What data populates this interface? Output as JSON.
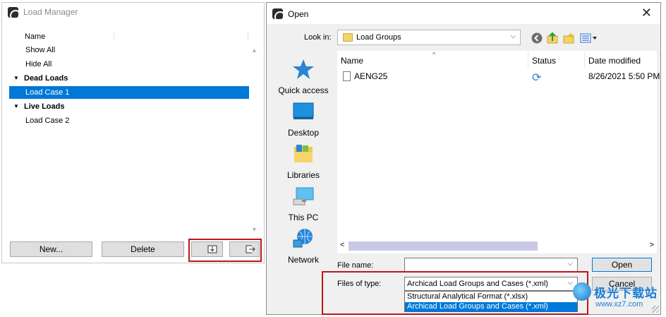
{
  "load_manager": {
    "title": "Load Manager",
    "column_header": "Name",
    "items": [
      {
        "label": "Show All",
        "kind": "item"
      },
      {
        "label": "Hide All",
        "kind": "item"
      },
      {
        "label": "Dead Loads",
        "kind": "group"
      },
      {
        "label": "Load Case 1",
        "kind": "item",
        "selected": true
      },
      {
        "label": "Live Loads",
        "kind": "group"
      },
      {
        "label": "Load Case 2",
        "kind": "item"
      }
    ],
    "buttons": {
      "new": "New...",
      "delete": "Delete"
    },
    "icons": {
      "import": "import-icon",
      "export": "export-icon"
    }
  },
  "open_dialog": {
    "title": "Open",
    "close_glyph": "✕",
    "look_in_label": "Look in:",
    "look_in_value": "Load Groups",
    "toolbar_icons": [
      "back-icon",
      "up-folder-icon",
      "new-folder-icon",
      "view-menu-icon"
    ],
    "places": [
      "Quick access",
      "Desktop",
      "Libraries",
      "This PC",
      "Network"
    ],
    "columns": {
      "name": "Name",
      "status": "Status",
      "date": "Date modified"
    },
    "files": [
      {
        "name": "AENG25",
        "status_icon": "sync-icon",
        "date": "8/26/2021 5:50 PM"
      }
    ],
    "file_name_label": "File name:",
    "file_name_value": "",
    "files_of_type_label": "Files of type:",
    "files_of_type_value": "Archicad Load Groups and Cases (*.xml)",
    "type_options": [
      {
        "label": "Structural Analytical Format (*.xlsx)",
        "selected": false
      },
      {
        "label": "Archicad Load Groups and Cases (*.xml)",
        "selected": true
      }
    ],
    "open_button": "Open",
    "cancel_button": "Cancel"
  },
  "watermark": {
    "line1": "极光下载站",
    "line2": "www.xz7.com"
  },
  "colors": {
    "selection": "#0078d7",
    "highlight_box": "#c0161a"
  }
}
